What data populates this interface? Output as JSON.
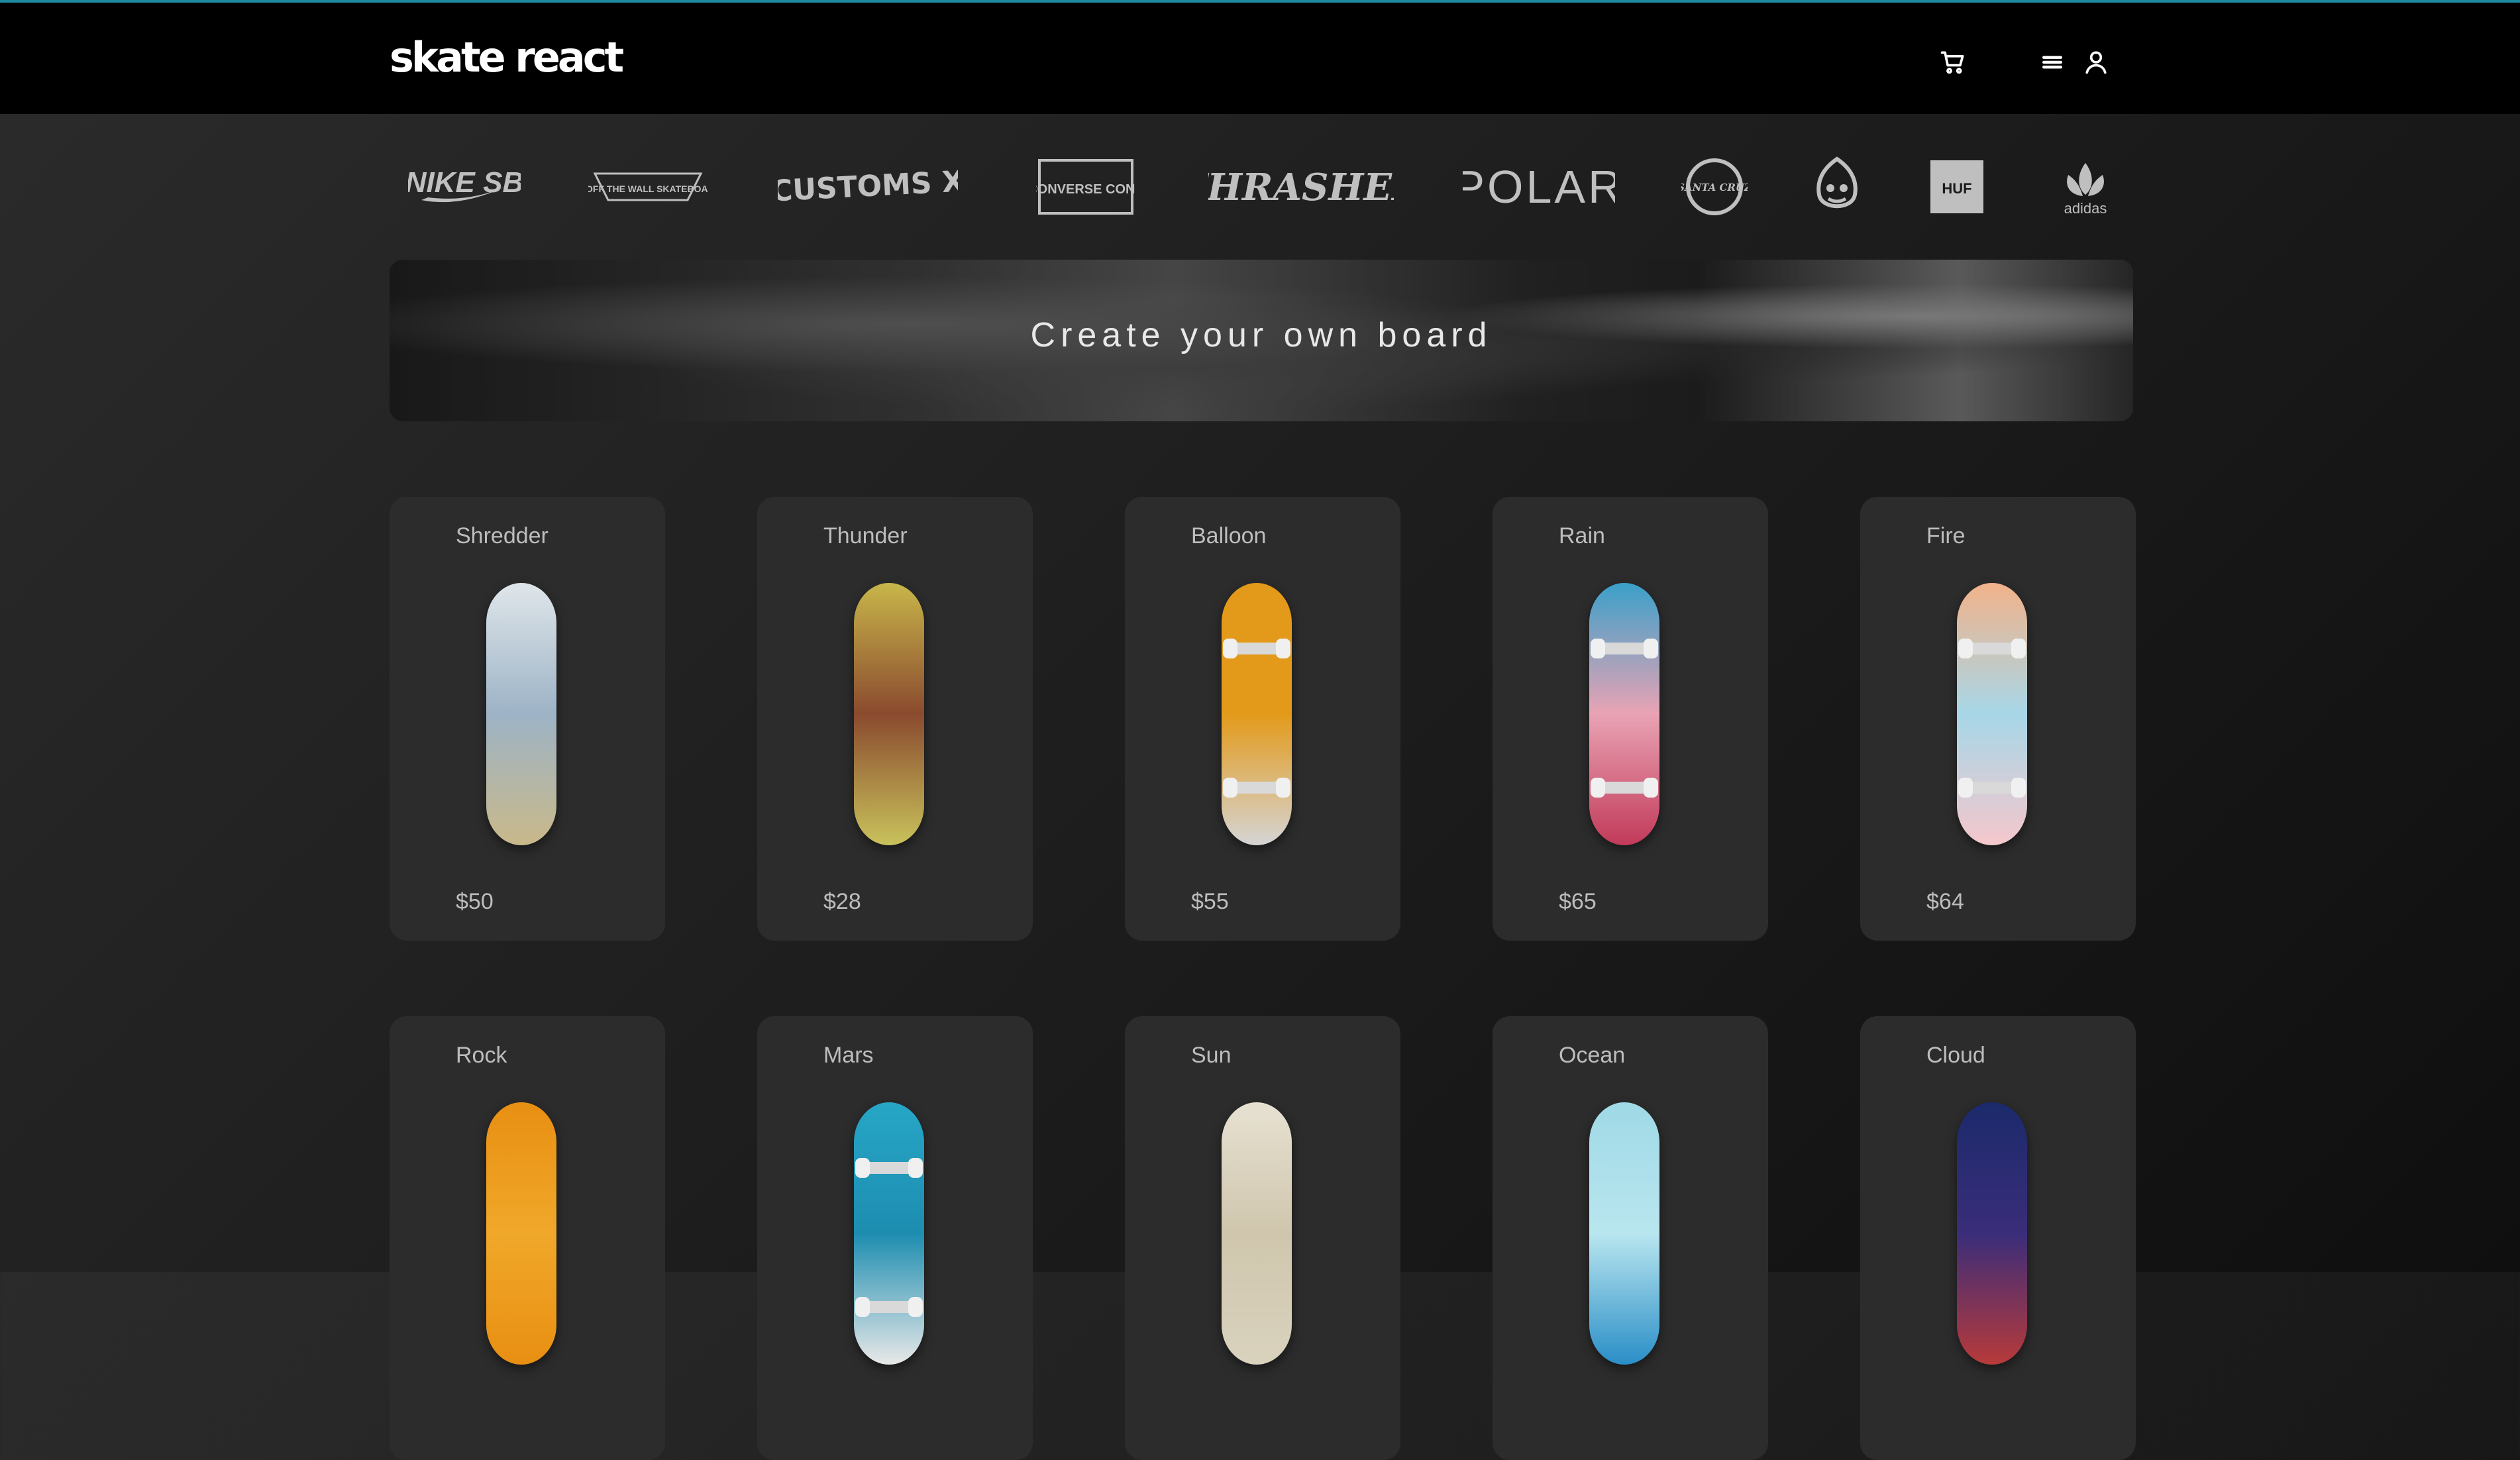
{
  "header": {
    "logo": "skate react",
    "icons": [
      "cart-icon",
      "menu-icon",
      "user-icon"
    ]
  },
  "brands": [
    {
      "name": "nike-sb",
      "label": "NIKE SB"
    },
    {
      "name": "vans",
      "label": "VANS OFF THE WALL SKATEBOARDING"
    },
    {
      "name": "customs",
      "label": "[CUSTOMS X]"
    },
    {
      "name": "converse-cons",
      "label": "CONVERSE CONS"
    },
    {
      "name": "thrasher",
      "label": "THRASHER"
    },
    {
      "name": "polar",
      "label": "POLAR"
    },
    {
      "name": "santa-cruz",
      "label": "SANTA CRUZ"
    },
    {
      "name": "spitfire",
      "label": ""
    },
    {
      "name": "huf",
      "label": "HUF"
    },
    {
      "name": "adidas",
      "label": "adidas"
    }
  ],
  "banner": {
    "title": "Create your own board"
  },
  "products": [
    {
      "name": "Shredder",
      "price": "$50",
      "colors": [
        "#dfe6ea",
        "#9db3c6",
        "#c9b98a"
      ]
    },
    {
      "name": "Thunder",
      "price": "$28",
      "colors": [
        "#c8b64a",
        "#8a4a2e",
        "#c9c25c"
      ]
    },
    {
      "name": "Balloon",
      "price": "$55",
      "colors": [
        "#e39a1a",
        "#e39a1a",
        "#d5d5d5"
      ]
    },
    {
      "name": "Rain",
      "price": "$65",
      "colors": [
        "#3aa0c9",
        "#e9a3b4",
        "#c23a5a"
      ]
    },
    {
      "name": "Fire",
      "price": "$64",
      "colors": [
        "#f2b28a",
        "#a7d7e8",
        "#f5c7cc"
      ]
    },
    {
      "name": "Rock",
      "price": "",
      "colors": [
        "#e88f12",
        "#f0a82a",
        "#e88f12"
      ]
    },
    {
      "name": "Mars",
      "price": "",
      "colors": [
        "#27a6c6",
        "#1d8db0",
        "#e8e8e8"
      ]
    },
    {
      "name": "Sun",
      "price": "",
      "colors": [
        "#e7e1d2",
        "#cfc6ad",
        "#d9d2bd"
      ]
    },
    {
      "name": "Ocean",
      "price": "",
      "colors": [
        "#9fd9e6",
        "#b9e6ef",
        "#2a8ec7"
      ]
    },
    {
      "name": "Cloud",
      "price": "",
      "colors": [
        "#1b2a6b",
        "#3a2d7a",
        "#b83a3a"
      ]
    }
  ]
}
